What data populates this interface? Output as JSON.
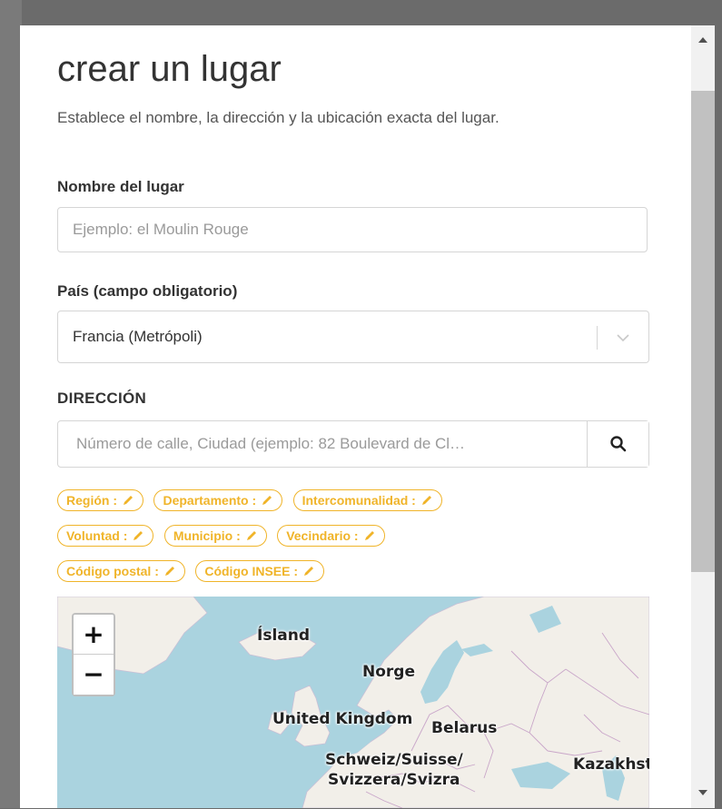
{
  "modal": {
    "title": "crear un lugar",
    "subtitle": "Establece el nombre, la dirección y la ubicación exacta del lugar."
  },
  "name_field": {
    "label": "Nombre del lugar",
    "placeholder": "Ejemplo: el Moulin Rouge",
    "value": ""
  },
  "country_field": {
    "label": "País (campo obligatorio)",
    "selected": "Francia (Metrópoli)"
  },
  "address_field": {
    "label": "DIRECCIÓN",
    "placeholder": "Número de calle, Ciudad (ejemplo: 82 Boulevard de Cl…",
    "search_icon": "search-icon"
  },
  "tags": [
    [
      "Región :",
      "Departamento :",
      "Intercomunalidad :"
    ],
    [
      "Voluntad :",
      "Municipio :",
      "Vecindario :"
    ],
    [
      "Código postal :",
      "Código INSEE :"
    ]
  ],
  "tag_icon": "pencil-icon",
  "map": {
    "zoom_in": "+",
    "zoom_out": "−",
    "labels": {
      "iceland": "Ísland",
      "norway": "Norge",
      "uk": "United Kingdom",
      "belarus": "Belarus",
      "switzerland_1": "Schweiz/Suisse/",
      "switzerland_2": "Svizzera/Svizra",
      "kazakhstan": "Kazakhsta"
    }
  },
  "colors": {
    "tag_accent": "#f0b429",
    "water": "#aad3df",
    "land": "#f2efe9"
  }
}
